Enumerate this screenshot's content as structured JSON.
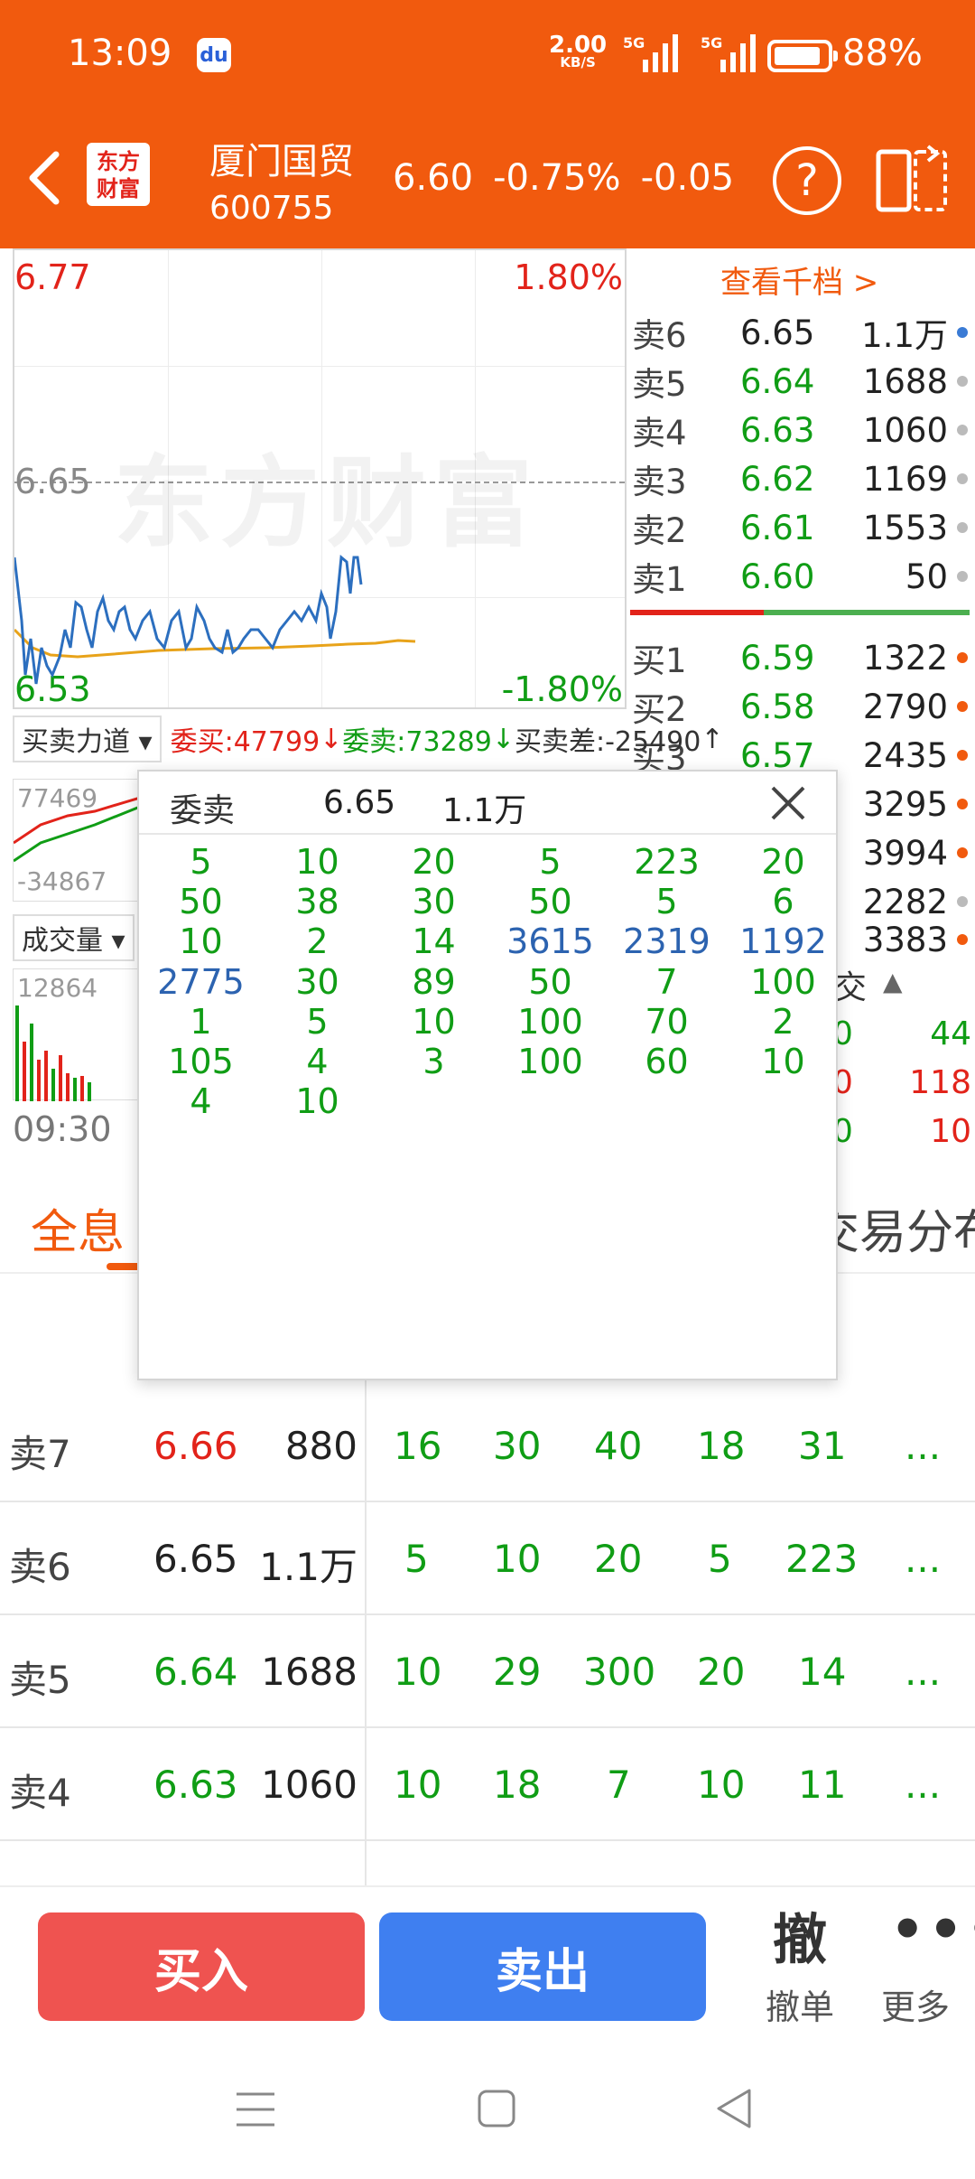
{
  "status_bar": {
    "time": "13:09",
    "net_speed": "2.00",
    "net_unit": "KB/S",
    "net1": "5G",
    "net2": "5G",
    "battery": "88%"
  },
  "header": {
    "logo_text_line1": "东方",
    "logo_text_line2": "财富",
    "stock_name": "厦门国贸",
    "stock_code": "600755",
    "price": "6.60",
    "change_pct": "-0.75%",
    "change": "-0.05"
  },
  "chart": {
    "high": "6.77",
    "high_pct": "1.80%",
    "mid": "6.65",
    "low": "6.53",
    "low_pct": "-1.80%",
    "watermark": "东方财富"
  },
  "orderbook": {
    "link": "查看千档 >",
    "asks": [
      {
        "label": "卖6",
        "price": "6.65",
        "vol": "1.1万",
        "dot": "#3a7bd5"
      },
      {
        "label": "卖5",
        "price": "6.64",
        "vol": "1688",
        "dot": "#bbbbbb"
      },
      {
        "label": "卖4",
        "price": "6.63",
        "vol": "1060",
        "dot": "#bbbbbb"
      },
      {
        "label": "卖3",
        "price": "6.62",
        "vol": "1169",
        "dot": "#bbbbbb"
      },
      {
        "label": "卖2",
        "price": "6.61",
        "vol": "1553",
        "dot": "#bbbbbb"
      },
      {
        "label": "卖1",
        "price": "6.60",
        "vol": "50",
        "dot": "#bbbbbb"
      }
    ],
    "bids": [
      {
        "label": "买1",
        "price": "6.59",
        "vol": "1322",
        "dot": "#f15a0e"
      },
      {
        "label": "买2",
        "price": "6.58",
        "vol": "2790",
        "dot": "#f15a0e"
      },
      {
        "label": "买3",
        "price": "6.57",
        "vol": "2435",
        "dot": "#f15a0e"
      }
    ],
    "hidden_vols": [
      "3295",
      "3994",
      "2282",
      "3383"
    ]
  },
  "strength": {
    "dropdown": "买卖力道",
    "weibuy": "委买:47799",
    "weisell": "委卖:73289",
    "diff": "买卖差:-25490"
  },
  "mini": {
    "v1": "77469",
    "v2": "-34867",
    "vol_dropdown": "成交量",
    "v3": "12864",
    "time": "09:30"
  },
  "right_mid": {
    "header": "交",
    "rows": [
      {
        "a": "0",
        "b": "44"
      },
      {
        "a": "0",
        "b": "118"
      },
      {
        "a": "0",
        "b": "10"
      }
    ]
  },
  "tabs": {
    "full": "全息",
    "dist": "交易分布"
  },
  "popup": {
    "title": "委卖",
    "price": "6.65",
    "vol": "1.1万",
    "cells": [
      [
        "5",
        "10",
        "20",
        "5",
        "223",
        "20"
      ],
      [
        "50",
        "38",
        "30",
        "50",
        "5",
        "6"
      ],
      [
        "10",
        "2",
        "14",
        "3615",
        "2319",
        "1192"
      ],
      [
        "2775",
        "30",
        "89",
        "50",
        "7",
        "100"
      ],
      [
        "1",
        "5",
        "10",
        "100",
        "70",
        "2"
      ],
      [
        "105",
        "4",
        "3",
        "100",
        "60",
        "10"
      ],
      [
        "4",
        "10"
      ]
    ],
    "blue_cells": [
      "3615",
      "2319",
      "1192",
      "2775"
    ]
  },
  "queue_table": [
    {
      "label": "卖7",
      "price": "6.66",
      "vol": "880",
      "q": [
        "16",
        "30",
        "40",
        "18",
        "31"
      ],
      "more": "...",
      "price_color": "#e2231a"
    },
    {
      "label": "卖6",
      "price": "6.65",
      "vol": "1.1万",
      "q": [
        "5",
        "10",
        "20",
        "5",
        "223"
      ],
      "more": "...",
      "price_color": "#222222"
    },
    {
      "label": "卖5",
      "price": "6.64",
      "vol": "1688",
      "q": [
        "10",
        "29",
        "300",
        "20",
        "14"
      ],
      "more": "...",
      "price_color": "#109d15"
    },
    {
      "label": "卖4",
      "price": "6.63",
      "vol": "1060",
      "q": [
        "10",
        "18",
        "7",
        "10",
        "11"
      ],
      "more": "...",
      "price_color": "#109d15"
    }
  ],
  "actions": {
    "buy": "买入",
    "sell": "卖出",
    "cancel_icon": "撤",
    "cancel": "撤单",
    "more": "更多"
  },
  "colors": {
    "brand": "#f15a0e",
    "up": "#e2231a",
    "down": "#109d15",
    "buy_btn": "#ef5350",
    "sell_btn": "#3f7ff0"
  }
}
